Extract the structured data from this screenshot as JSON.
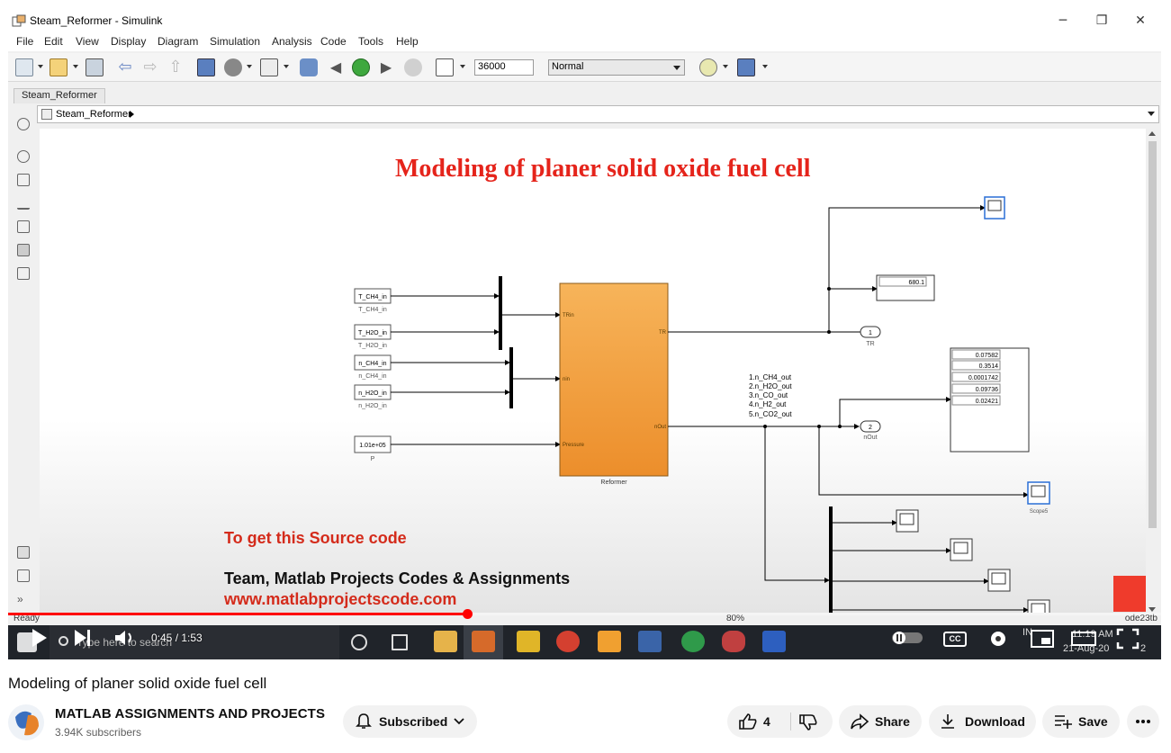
{
  "window": {
    "title": "Steam_Reformer - Simulink",
    "minimize": "─",
    "restore": "❐",
    "close": "✕"
  },
  "menu": [
    "File",
    "Edit",
    "View",
    "Display",
    "Diagram",
    "Simulation",
    "Analysis",
    "Code",
    "Tools",
    "Help"
  ],
  "toolbar": {
    "stop_time": "36000",
    "sim_mode": "Normal"
  },
  "tab": "Steam_Reformer",
  "breadcrumb": "Steam_Reformer",
  "diagram": {
    "heading": "Modeling of planer solid oxide fuel cell",
    "inputs": [
      {
        "block": "T_CH4_in",
        "label": "T_CH4_in"
      },
      {
        "block": "T_H2O_in",
        "label": "T_H2O_in"
      },
      {
        "block": "n_CH4_in",
        "label": "n_CH4_in"
      },
      {
        "block": "n_H2O_in",
        "label": "n_H2O_in"
      }
    ],
    "pressure": {
      "block": "1.01e+05",
      "label": "P"
    },
    "reformer": {
      "label": "Reformer",
      "port_tin": "TRin",
      "port_nin": "nin",
      "port_pin": "Pressure",
      "port_tr": "TR",
      "port_nout": "nOut"
    },
    "display_temp": "680.1",
    "out_tr": {
      "num": "1",
      "label": "TR"
    },
    "out_nout": {
      "num": "2",
      "label": "nOut"
    },
    "legend": [
      "1.n_CH4_out",
      "2.n_H2O_out",
      "3.n_CO_out",
      "4.n_H2_out",
      "5.n_CO2_out"
    ],
    "display_values": [
      "0.07582",
      "0.3514",
      "0.0001742",
      "0.09736",
      "0.02421"
    ],
    "scope_label": "Scope5"
  },
  "overlay": {
    "line1": "To get this Source code",
    "line2": "Team, Matlab Projects Codes & Assignments",
    "line3": "www.matlabprojectscode.com"
  },
  "status": {
    "ready": "Ready",
    "zoom": "80%",
    "solver": "ode23tb"
  },
  "taskbar": {
    "search_placeholder": "Type here to search",
    "time": "11:19 AM",
    "date": "21-Aug-20",
    "lang": "IN",
    "notif_count": "2"
  },
  "player": {
    "time": "0:45 / 1:53",
    "progress_fraction": 0.398,
    "cc": "CC"
  },
  "video": {
    "title": "Modeling of planer solid oxide fuel cell",
    "channel": "MATLAB ASSIGNMENTS AND PROJECTS",
    "subscribers": "3.94K subscribers",
    "subscribe_label": "Subscribed",
    "likes": "4",
    "share": "Share",
    "download": "Download",
    "save": "Save"
  },
  "colors": {
    "heading_red": "#e5241b",
    "reformer_orange": "#f2a33a",
    "progress_red": "#ff0000",
    "taskbar": "#20242a"
  }
}
